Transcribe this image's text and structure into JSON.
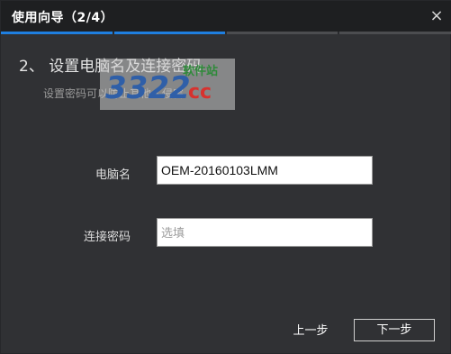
{
  "window": {
    "title": "使用向导（2/4）",
    "close_glyph": "×"
  },
  "progress": {
    "current_step": 2,
    "total_steps": 4,
    "active_color": "#1f7fe0",
    "inactive_color": "#4c4d50"
  },
  "step": {
    "heading": "2、 设置电脑名及连接密码",
    "description": "设置密码可以防止其他人侵害"
  },
  "watermark": {
    "number_text": "3322",
    "suffix_text": "cc",
    "tag_text": "软件站"
  },
  "form": {
    "computer_name": {
      "label": "电脑名",
      "value": "OEM-20160103LMM"
    },
    "password": {
      "label": "连接密码",
      "value": "",
      "placeholder": "选填"
    }
  },
  "footer": {
    "prev_label": "上一步",
    "next_label": "下一步"
  }
}
